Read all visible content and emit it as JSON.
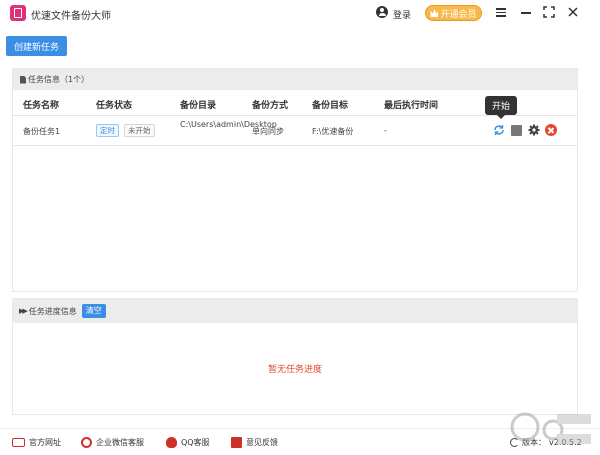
{
  "app": {
    "title": "优速文件备份大师"
  },
  "header": {
    "login_label": "登录",
    "vip_label": "开通会员"
  },
  "toolbar": {
    "create_label": "创建新任务"
  },
  "task_panel": {
    "title": "任务信息（1个）",
    "columns": [
      "任务名称",
      "任务状态",
      "备份目录",
      "备份方式",
      "备份目标",
      "最后执行时间"
    ],
    "rows": [
      {
        "name": "备份任务1",
        "tag_schedule": "定时",
        "status": "未开始",
        "source_dir": "C:\\Users\\admin\\Desktop",
        "method": "单向同步",
        "target": "F:\\优速备份",
        "last_run": "-"
      }
    ],
    "tooltip": "开始"
  },
  "progress_panel": {
    "title": "任务进度信息",
    "clear_label": "清空",
    "empty_message": "暂无任务进度"
  },
  "footer": {
    "links": [
      "官方网址",
      "企业微信客服",
      "QQ客服",
      "意见反馈"
    ],
    "version_label": "版本：",
    "version": "v2.0.5.2"
  },
  "colors": {
    "primary": "#3a8ee6",
    "danger": "#e3472e",
    "vip": "#f8b94a",
    "brand": "#e0307a"
  }
}
